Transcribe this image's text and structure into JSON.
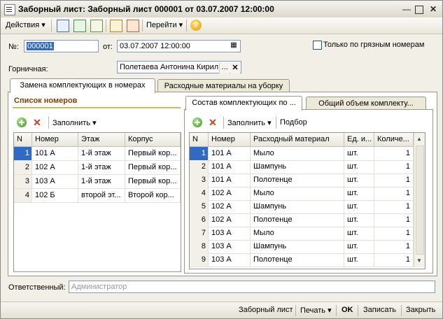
{
  "window": {
    "title": "Заборный лист: Заборный лист 000001 от 03.07.2007 12:00:00"
  },
  "toolbar": {
    "actions_label": "Действия",
    "goto_label": "Перейти"
  },
  "header": {
    "number_label": "№:",
    "number_value": "000001",
    "date_label": "от:",
    "date_value": "03.07.2007 12:00:00",
    "dirty_only_label": "Только по грязным номерам",
    "maid_label": "Горничная:",
    "maid_value": "Полетаева Антонина Кирил",
    "maid_select": "..."
  },
  "tabs": {
    "main": [
      "Замена комплектующих  в номерах",
      "Расходные материалы на уборку"
    ],
    "sub": [
      "Состав комплектующих по ...",
      "Общий объем комплекту..."
    ]
  },
  "rooms": {
    "title": "Список номеров",
    "fill_label": "Заполнить",
    "columns": [
      "N",
      "Номер",
      "Этаж",
      "Корпус"
    ],
    "rows": [
      [
        "1",
        "101 А",
        "1-й этаж",
        "Первый кор..."
      ],
      [
        "2",
        "102 А",
        "1-й этаж",
        "Первый кор..."
      ],
      [
        "3",
        "103 А",
        "1-й этаж",
        "Первый кор..."
      ],
      [
        "4",
        "102 Б",
        "второй эт...",
        "Второй кор..."
      ]
    ]
  },
  "components": {
    "fill_label": "Заполнить",
    "select_label": "Подбор",
    "columns": [
      "N",
      "Номер",
      "Расходный материал",
      "Ед. и...",
      "Количе..."
    ],
    "rows": [
      [
        "1",
        "101 А",
        "Мыло",
        "шт.",
        "1"
      ],
      [
        "2",
        "101 А",
        "Шампунь",
        "шт.",
        "1"
      ],
      [
        "3",
        "101 А",
        "Полотенце",
        "шт.",
        "1"
      ],
      [
        "4",
        "102 А",
        "Мыло",
        "шт.",
        "1"
      ],
      [
        "5",
        "102 А",
        "Шампунь",
        "шт.",
        "1"
      ],
      [
        "6",
        "102 А",
        "Полотенце",
        "шт.",
        "1"
      ],
      [
        "7",
        "103 А",
        "Мыло",
        "шт.",
        "1"
      ],
      [
        "8",
        "103 А",
        "Шампунь",
        "шт.",
        "1"
      ],
      [
        "9",
        "103 А",
        "Полотенце",
        "шт.",
        "1"
      ]
    ]
  },
  "footer": {
    "responsible_label": "Ответственный:",
    "responsible_placeholder": "Администратор"
  },
  "statusbar": {
    "doc": "Заборный лист",
    "print": "Печать",
    "ok": "OK",
    "save": "Записать",
    "close": "Закрыть"
  },
  "colors": {
    "selection": "#316ac5",
    "group_title": "#8b3a00"
  }
}
